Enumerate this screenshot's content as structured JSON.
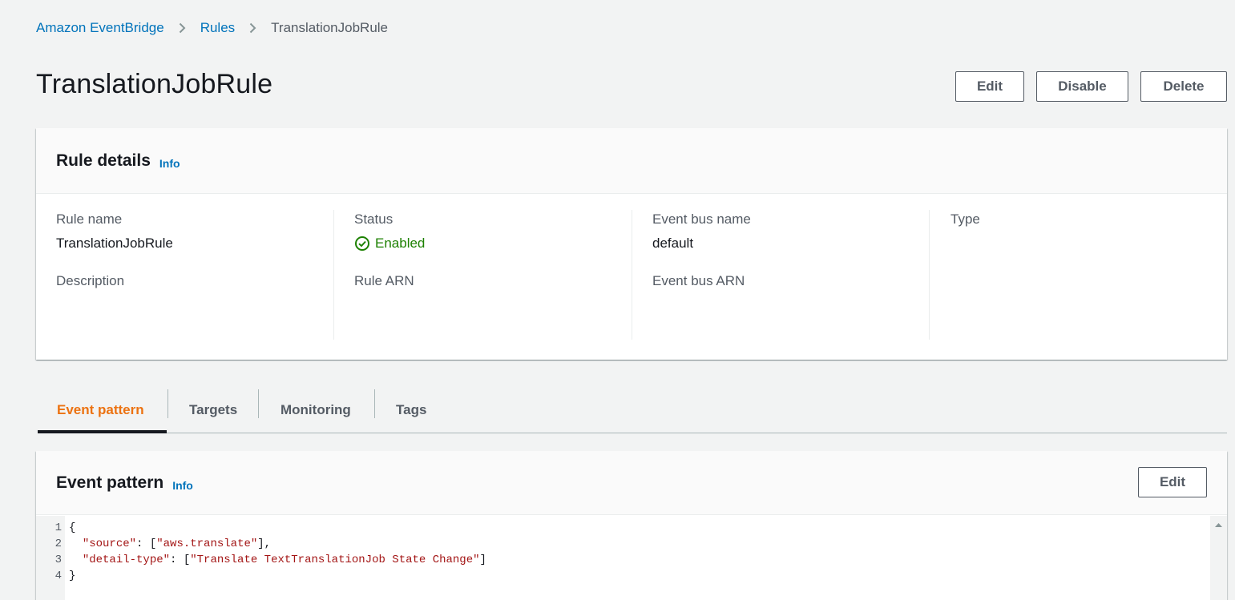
{
  "breadcrumb": {
    "items": [
      "Amazon EventBridge",
      "Rules",
      "TranslationJobRule"
    ]
  },
  "page": {
    "title": "TranslationJobRule",
    "actions": {
      "edit": "Edit",
      "disable": "Disable",
      "delete": "Delete"
    }
  },
  "rule_details": {
    "title": "Rule details",
    "info": "Info",
    "fields": {
      "rule_name_label": "Rule name",
      "rule_name_value": "TranslationJobRule",
      "description_label": "Description",
      "status_label": "Status",
      "status_value": "Enabled",
      "rule_arn_label": "Rule ARN",
      "event_bus_name_label": "Event bus name",
      "event_bus_name_value": "default",
      "event_bus_arn_label": "Event bus ARN",
      "type_label": "Type"
    }
  },
  "tabs": [
    "Event pattern",
    "Targets",
    "Monitoring",
    "Tags"
  ],
  "active_tab": "Event pattern",
  "event_pattern": {
    "title": "Event pattern",
    "info": "Info",
    "edit": "Edit",
    "lines": [
      {
        "num": "1",
        "open": "{"
      },
      {
        "num": "2",
        "key": "\"source\"",
        "sep": ": [",
        "val": "\"aws.translate\"",
        "end": "],"
      },
      {
        "num": "3",
        "key": "\"detail-type\"",
        "sep": ": [",
        "val": "\"Translate TextTranslationJob State Change\"",
        "end": "]"
      },
      {
        "num": "4",
        "open": "}"
      }
    ]
  },
  "colors": {
    "link": "#0073bb",
    "active_tab": "#ec7211",
    "status_enabled": "#1d8102",
    "code_string": "#a31515"
  }
}
